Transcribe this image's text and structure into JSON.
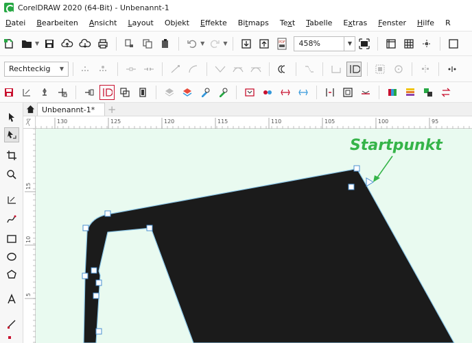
{
  "window": {
    "title": "CorelDRAW 2020 (64-Bit) - Unbenannt-1"
  },
  "menu": [
    {
      "pre": "",
      "acc": "D",
      "post": "atei"
    },
    {
      "pre": "",
      "acc": "B",
      "post": "earbeiten"
    },
    {
      "pre": "",
      "acc": "A",
      "post": "nsicht"
    },
    {
      "pre": "",
      "acc": "L",
      "post": "ayout"
    },
    {
      "pre": "Objekt",
      "acc": "",
      "post": ""
    },
    {
      "pre": "",
      "acc": "E",
      "post": "ffekte"
    },
    {
      "pre": "Bi",
      "acc": "t",
      "post": "maps"
    },
    {
      "pre": "Te",
      "acc": "x",
      "post": "t"
    },
    {
      "pre": "",
      "acc": "T",
      "post": "abelle"
    },
    {
      "pre": "E",
      "acc": "x",
      "post": "tras"
    },
    {
      "pre": "",
      "acc": "F",
      "post": "enster"
    },
    {
      "pre": "",
      "acc": "H",
      "post": "ilfe"
    },
    {
      "pre": "R",
      "acc": "",
      "post": ""
    }
  ],
  "toolbar": {
    "zoom_value": "458%",
    "pdf_label": "PDF"
  },
  "property_bar": {
    "shape_type": "Rechteckig"
  },
  "document": {
    "tab_label": "Unbenannt-1*"
  },
  "ruler": {
    "h_labels": [
      "130",
      "125",
      "120",
      "115",
      "110",
      "105",
      "100",
      "95"
    ],
    "v_labels": [
      "15",
      "10",
      "5"
    ]
  },
  "canvas": {
    "annotation": "Startpunkt",
    "fill_color": "#1b1b1b",
    "outline_color": "#8cc7e8",
    "annotation_color": "#35b449",
    "background_color": "#e9faf0"
  }
}
